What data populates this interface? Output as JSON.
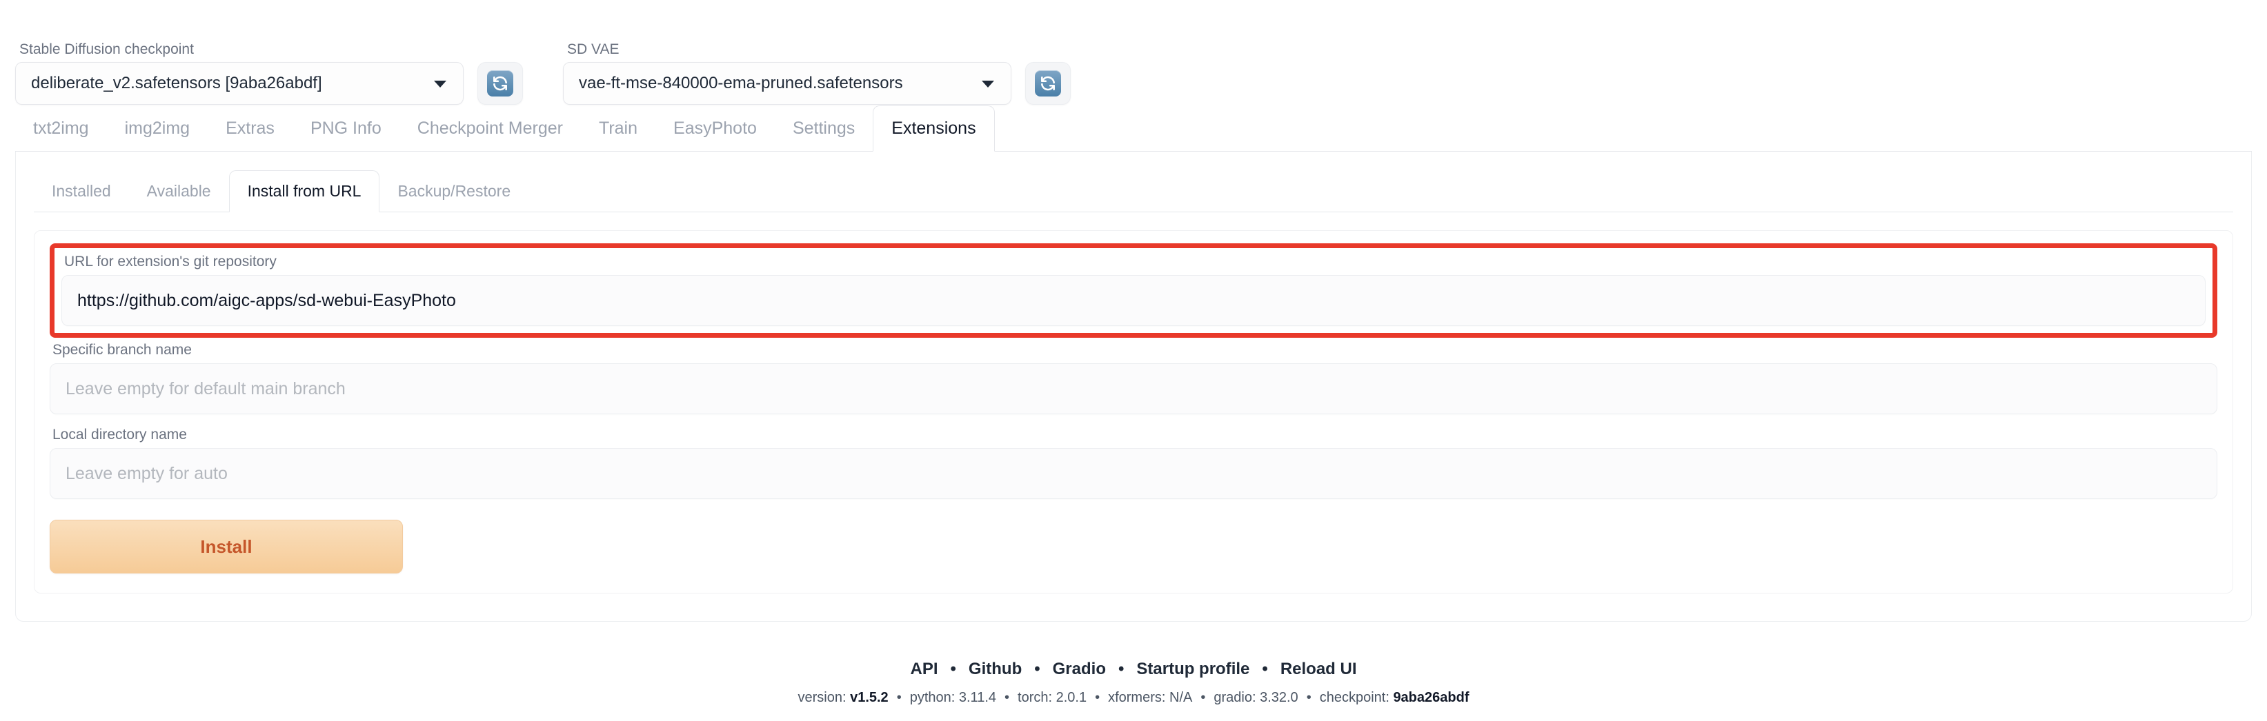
{
  "topbar": {
    "checkpoint": {
      "label": "Stable Diffusion checkpoint",
      "value": "deliberate_v2.safetensors [9aba26abdf]"
    },
    "vae": {
      "label": "SD VAE",
      "value": "vae-ft-mse-840000-ema-pruned.safetensors"
    },
    "refresh_icon": "refresh-icon"
  },
  "main_tabs": [
    {
      "label": "txt2img",
      "active": false
    },
    {
      "label": "img2img",
      "active": false
    },
    {
      "label": "Extras",
      "active": false
    },
    {
      "label": "PNG Info",
      "active": false
    },
    {
      "label": "Checkpoint Merger",
      "active": false
    },
    {
      "label": "Train",
      "active": false
    },
    {
      "label": "EasyPhoto",
      "active": false
    },
    {
      "label": "Settings",
      "active": false
    },
    {
      "label": "Extensions",
      "active": true
    }
  ],
  "sub_tabs": [
    {
      "label": "Installed",
      "active": false
    },
    {
      "label": "Available",
      "active": false
    },
    {
      "label": "Install from URL",
      "active": true
    },
    {
      "label": "Backup/Restore",
      "active": false
    }
  ],
  "form": {
    "url": {
      "label": "URL for extension's git repository",
      "value": "https://github.com/aigc-apps/sd-webui-EasyPhoto",
      "placeholder": ""
    },
    "branch": {
      "label": "Specific branch name",
      "value": "",
      "placeholder": "Leave empty for default main branch"
    },
    "local_dir": {
      "label": "Local directory name",
      "value": "",
      "placeholder": "Leave empty for auto"
    },
    "install_button": "Install"
  },
  "highlight": {
    "color": "#e8392a"
  },
  "footer": {
    "links": [
      "API",
      "Github",
      "Gradio",
      "Startup profile",
      "Reload UI"
    ],
    "separator": "•",
    "version": [
      {
        "key": "version:",
        "value": "v1.5.2",
        "bold": true
      },
      {
        "key": "python:",
        "value": "3.11.4",
        "bold": false
      },
      {
        "key": "torch:",
        "value": "2.0.1",
        "bold": false
      },
      {
        "key": "xformers:",
        "value": "N/A",
        "bold": false
      },
      {
        "key": "gradio:",
        "value": "3.32.0",
        "bold": false
      },
      {
        "key": "checkpoint:",
        "value": "9aba26abdf",
        "bold": true
      }
    ]
  }
}
